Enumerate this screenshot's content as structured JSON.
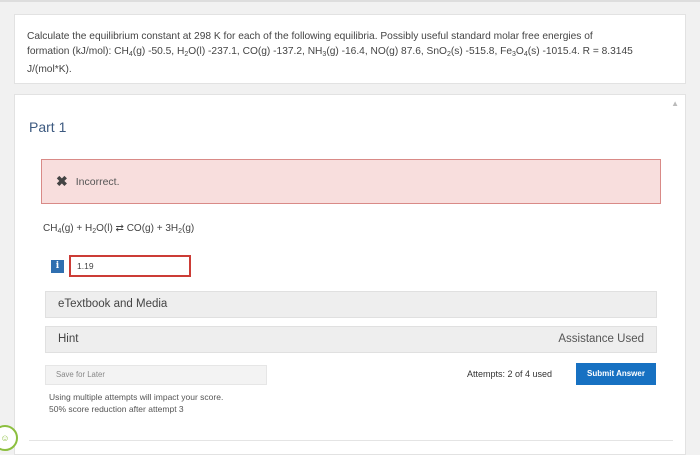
{
  "question": {
    "line1": "Calculate the equilibrium constant at 298 K for each of the following equilibria. Possibly useful standard molar free energies of",
    "line2_a": "formation (kJ/mol): CH",
    "line2_b": "(g) -50.5, H",
    "line2_c": "O(l) -237.1, CO(g) -137.2, NH",
    "line2_d": "(g) -16.4, NO(g) 87.6, SnO",
    "line2_e": "(s) -515.8, Fe",
    "line2_f": "O",
    "line2_g": "(s) -1015.4. R = 8.3145",
    "line3": "J/(mol*K).",
    "sub_4": "4",
    "sub_2": "2",
    "sub_3": "3"
  },
  "part": {
    "title": "Part 1"
  },
  "feedback": {
    "icon": "✖",
    "text": "Incorrect."
  },
  "reaction": {
    "a": "CH",
    "b": "(g) + H",
    "c": "O(l) ⇄ CO(g) + 3H",
    "d": "(g)"
  },
  "answer": {
    "info_icon": "i",
    "value": "1.19"
  },
  "etextbook": {
    "label": "eTextbook and Media"
  },
  "hint": {
    "label": "Hint",
    "assistance": "Assistance Used"
  },
  "actions": {
    "save_later": "Save for Later",
    "attempts": "Attempts: 2 of 4 used",
    "submit": "Submit Answer"
  },
  "policy": {
    "line1": "Using multiple attempts will impact your score.",
    "line2": "50% score reduction after attempt 3"
  },
  "colors": {
    "accent": "#1771c2",
    "error_border": "#cc3c36",
    "error_bg": "#f8dedd",
    "info_icon": "#2f6fb0"
  }
}
